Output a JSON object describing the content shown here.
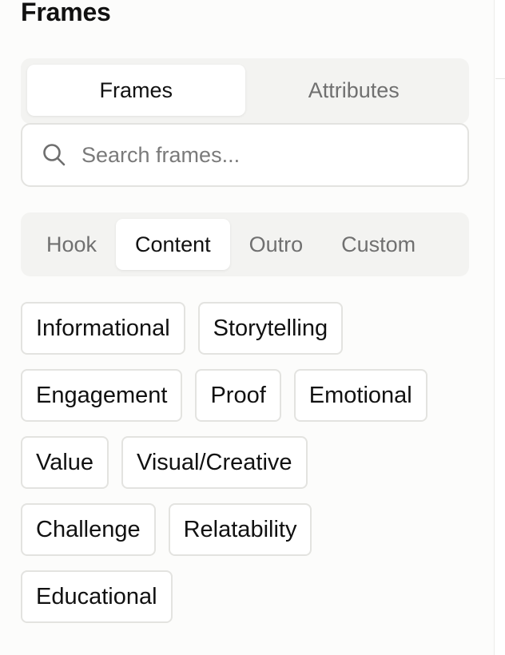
{
  "panel": {
    "title": "Frames"
  },
  "main_tabs": [
    {
      "label": "Frames",
      "active": true
    },
    {
      "label": "Attributes",
      "active": false
    }
  ],
  "search": {
    "placeholder": "Search frames...",
    "value": "",
    "icon": "search-icon"
  },
  "sub_tabs": [
    {
      "label": "Hook",
      "active": false
    },
    {
      "label": "Content",
      "active": true
    },
    {
      "label": "Outro",
      "active": false
    },
    {
      "label": "Custom",
      "active": false
    }
  ],
  "frames": {
    "rows": [
      [
        "Informational",
        "Storytelling"
      ],
      [
        "Engagement",
        "Proof",
        "Emotional"
      ],
      [
        "Value",
        "Visual/Creative"
      ],
      [
        "Challenge",
        "Relatability"
      ],
      [
        "Educational"
      ]
    ]
  },
  "colors": {
    "panel_background": "#fcfcfb",
    "segment_background": "#f3f3f1",
    "active_tab_background": "#ffffff",
    "inactive_text": "#707070",
    "border": "#e3e3e0"
  }
}
